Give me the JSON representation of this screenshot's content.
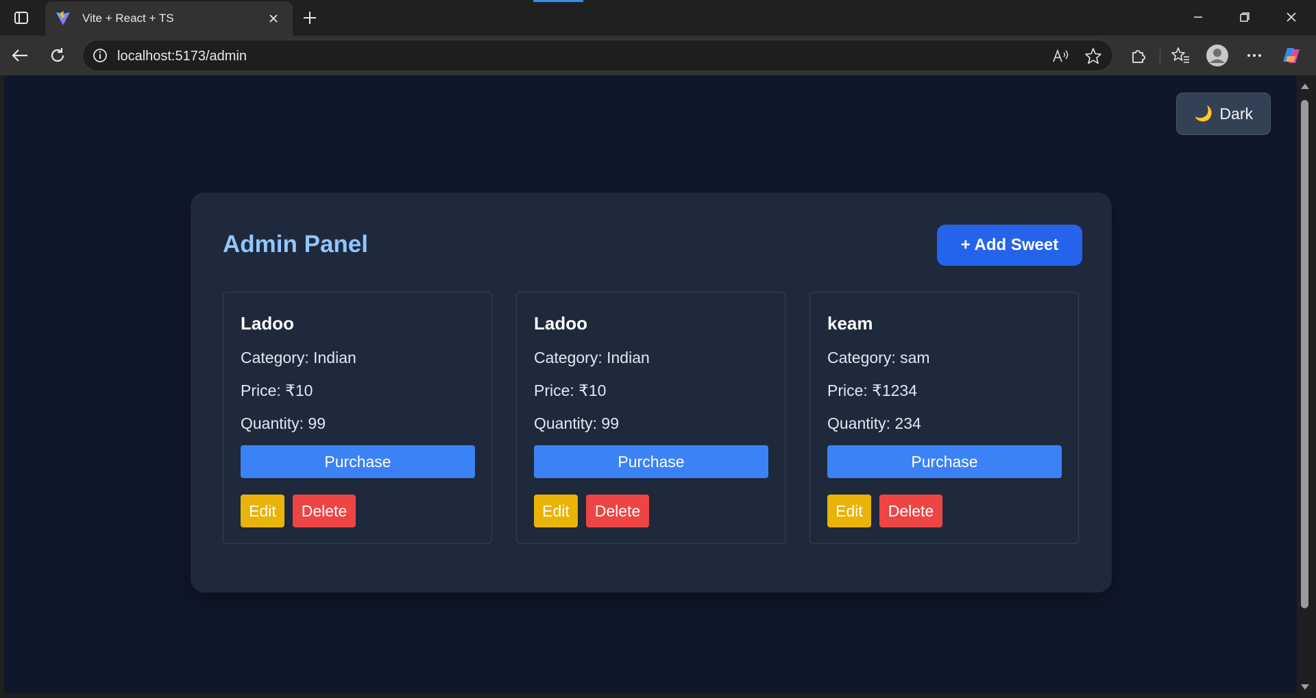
{
  "browser": {
    "tab_title": "Vite + React + TS",
    "url": "localhost:5173/admin"
  },
  "theme_toggle": {
    "icon": "🌙",
    "label": "Dark"
  },
  "admin": {
    "title": "Admin Panel",
    "add_button": "+ Add Sweet"
  },
  "sweets": [
    {
      "name": "Ladoo",
      "category": "Category: Indian",
      "price": "Price: ₹10",
      "quantity": "Quantity: 99",
      "purchase": "Purchase",
      "edit": "Edit",
      "delete": "Delete"
    },
    {
      "name": "Ladoo",
      "category": "Category: Indian",
      "price": "Price: ₹10",
      "quantity": "Quantity: 99",
      "purchase": "Purchase",
      "edit": "Edit",
      "delete": "Delete"
    },
    {
      "name": "keam",
      "category": "Category: sam",
      "price": "Price: ₹1234",
      "quantity": "Quantity: 234",
      "purchase": "Purchase",
      "edit": "Edit",
      "delete": "Delete"
    }
  ],
  "colors": {
    "page_bg": "#0f172a",
    "panel_bg": "#1e293b",
    "title": "#93c5fd",
    "primary": "#2563eb",
    "purchase": "#3b82f6",
    "edit": "#eab308",
    "delete": "#ef4444"
  }
}
